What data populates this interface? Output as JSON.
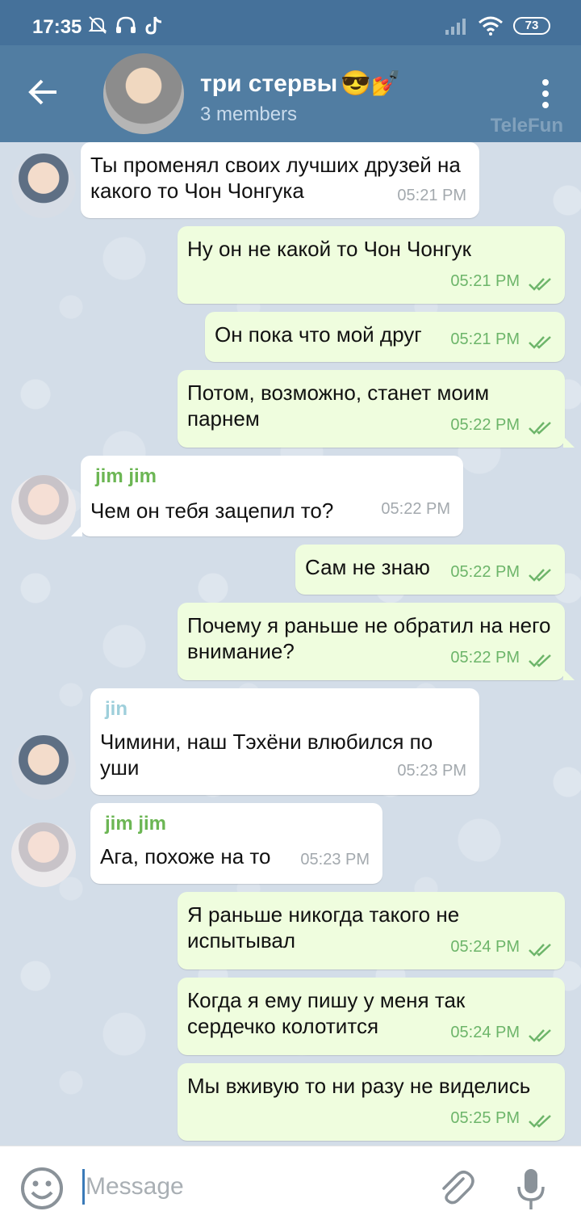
{
  "status_bar": {
    "time": "17:35",
    "battery": "73",
    "icons": [
      "mute-icon",
      "headphones-icon",
      "tiktok-icon",
      "signal-icon",
      "wifi-icon",
      "battery-icon"
    ]
  },
  "header": {
    "title": "три стервы",
    "title_emojis": "😎💅",
    "subtitle": "3 members",
    "watermark": "TeleFun"
  },
  "messages": [
    {
      "direction": "in",
      "sender": "",
      "text": "Ты променял своих лучших друзей на какого то Чон Чонгука",
      "time": "05:21 PM"
    },
    {
      "direction": "out",
      "text": "Ну он не какой то Чон Чонгук",
      "time": "05:21 PM"
    },
    {
      "direction": "out",
      "text": "Он пока что мой друг",
      "time": "05:21 PM"
    },
    {
      "direction": "out",
      "text": "Потом, возможно, станет моим парнем",
      "time": "05:22 PM"
    },
    {
      "direction": "in",
      "sender": "jim jim",
      "text": "Чем он тебя зацепил то?",
      "time": "05:22 PM"
    },
    {
      "direction": "out",
      "text": "Сам не знаю",
      "time": "05:22 PM"
    },
    {
      "direction": "out",
      "text": "Почему я раньше не обратил на него внимание?",
      "time": "05:22 PM"
    },
    {
      "direction": "in",
      "sender": "jin",
      "text": "Чимини, наш Тэхёни влюбился по уши",
      "time": "05:23 PM"
    },
    {
      "direction": "in",
      "sender": "jim jim",
      "text": "Ага, похоже на то",
      "time": "05:23 PM"
    },
    {
      "direction": "out",
      "text": "Я раньше никогда такого не испытывал",
      "time": "05:24 PM"
    },
    {
      "direction": "out",
      "text": "Когда я ему пишу у меня так сердечко колотится",
      "time": "05:24 PM"
    },
    {
      "direction": "out",
      "text": "Мы вживую то ни разу не виделись",
      "time": "05:25 PM"
    }
  ],
  "input": {
    "placeholder": "Message"
  },
  "colors": {
    "header": "#517da2",
    "status_bar": "#45719a",
    "incoming_bubble": "#ffffff",
    "outgoing_bubble": "#effdde",
    "outgoing_time": "#6db56a",
    "sender_green": "#6cb654",
    "sender_jin": "#9ecfdb"
  }
}
